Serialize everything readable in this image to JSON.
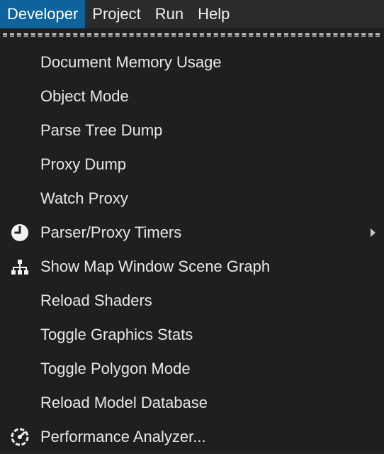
{
  "menubar": {
    "items": [
      {
        "label": "Developer",
        "active": true
      },
      {
        "label": "Project",
        "active": false
      },
      {
        "label": "Run",
        "active": false
      },
      {
        "label": "Help",
        "active": false
      }
    ]
  },
  "dropdown": {
    "items": [
      {
        "label": "Document Memory Usage",
        "icon": null,
        "submenu": false
      },
      {
        "label": "Object Mode",
        "icon": null,
        "submenu": false
      },
      {
        "label": "Parse Tree Dump",
        "icon": null,
        "submenu": false
      },
      {
        "label": "Proxy Dump",
        "icon": null,
        "submenu": false
      },
      {
        "label": "Watch Proxy",
        "icon": null,
        "submenu": false
      },
      {
        "label": "Parser/Proxy Timers",
        "icon": "clock-icon",
        "submenu": true
      },
      {
        "label": "Show Map Window Scene Graph",
        "icon": "hierarchy-icon",
        "submenu": false
      },
      {
        "label": "Reload Shaders",
        "icon": null,
        "submenu": false
      },
      {
        "label": "Toggle Graphics Stats",
        "icon": null,
        "submenu": false
      },
      {
        "label": "Toggle Polygon Mode",
        "icon": null,
        "submenu": false
      },
      {
        "label": "Reload Model Database",
        "icon": null,
        "submenu": false
      },
      {
        "label": "Performance Analyzer...",
        "icon": "performance-gauge-icon",
        "submenu": false
      }
    ]
  },
  "colors": {
    "menubar_bg": "#2b2b2b",
    "active_bg": "#0e639c",
    "dropdown_bg": "#1f1f1f",
    "text": "#e8e8e8"
  }
}
